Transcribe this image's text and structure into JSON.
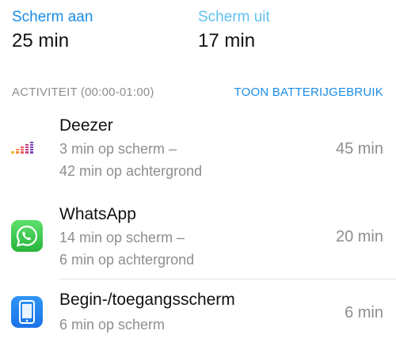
{
  "summary": {
    "screen_on": {
      "label": "Scherm aan",
      "value": "25 min",
      "color": "#1a8de6"
    },
    "screen_off": {
      "label": "Scherm uit",
      "value": "17 min",
      "color": "#5fc2f0"
    }
  },
  "activity": {
    "title": "ACTIVITEIT (00:00-01:00)",
    "action_label": "TOON BATTERIJGEBRUIK"
  },
  "apps": [
    {
      "name": "Deezer",
      "detail_line1": "3 min op scherm –",
      "detail_line2": "42 min op achtergrond",
      "total": "45 min",
      "icon": "deezer-icon"
    },
    {
      "name": "WhatsApp",
      "detail_line1": "14 min op scherm –",
      "detail_line2": "6 min op achtergrond",
      "total": "20 min",
      "icon": "whatsapp-icon"
    },
    {
      "name": "Begin-/toegangsscherm",
      "detail_line1": "6 min op scherm",
      "total": "6 min",
      "icon": "home-screen-icon"
    }
  ]
}
